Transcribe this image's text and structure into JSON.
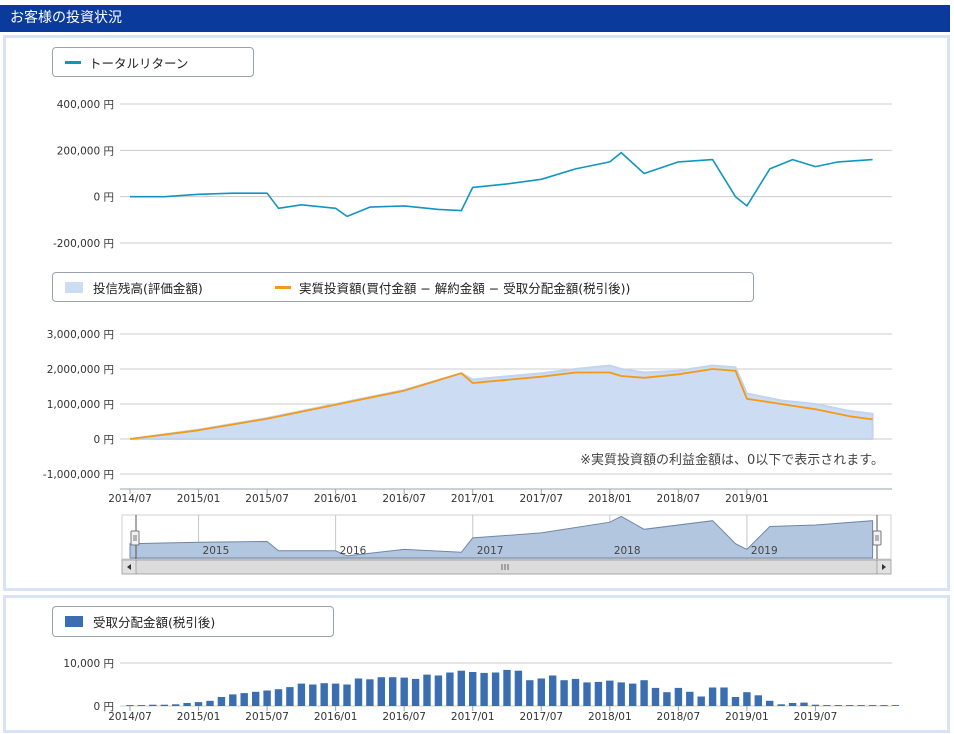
{
  "header": {
    "title": "お客様の投資状況"
  },
  "chart_data": [
    {
      "type": "line",
      "legend": [
        "トータルリターン"
      ],
      "yaxis_ticks": [
        "400,000 円",
        "200,000 円",
        "0 円",
        "-200,000 円"
      ],
      "ylim": [
        -200000,
        400000
      ],
      "xlim": [
        "2014-07",
        "2020-01"
      ],
      "colors": {
        "line": "#1296c1",
        "grid": "#c8c8c8"
      },
      "series": [
        {
          "name": "トータルリターン",
          "x": [
            "2014-07",
            "2014-10",
            "2015-01",
            "2015-04",
            "2015-07",
            "2015-08",
            "2015-10",
            "2016-01",
            "2016-02",
            "2016-04",
            "2016-07",
            "2016-10",
            "2016-12",
            "2017-01",
            "2017-04",
            "2017-07",
            "2017-10",
            "2018-01",
            "2018-02",
            "2018-04",
            "2018-07",
            "2018-10",
            "2018-12",
            "2019-01",
            "2019-03",
            "2019-05",
            "2019-07",
            "2019-09",
            "2019-12"
          ],
          "values": [
            0,
            0,
            10000,
            15000,
            15000,
            -50000,
            -35000,
            -50000,
            -85000,
            -45000,
            -40000,
            -55000,
            -60000,
            40000,
            55000,
            75000,
            120000,
            150000,
            190000,
            100000,
            150000,
            160000,
            0,
            -40000,
            120000,
            160000,
            130000,
            150000,
            160000
          ]
        }
      ]
    },
    {
      "type": "area",
      "legend": [
        "投信残高(評価金額)",
        "実質投資額(買付金額 − 解約金額 − 受取分配金額(税引後))"
      ],
      "yaxis_ticks": [
        "3,000,000 円",
        "2,000,000 円",
        "1,000,000 円",
        "0 円",
        "-1,000,000 円"
      ],
      "ylim": [
        -1000000,
        3000000
      ],
      "x_ticks": [
        "2014/07",
        "2015/01",
        "2015/07",
        "2016/01",
        "2016/07",
        "2017/01",
        "2017/07",
        "2018/01",
        "2018/07",
        "2019/01"
      ],
      "xlim": [
        "2014-07",
        "2020-01"
      ],
      "note": "※実質投資額の利益金額は、0以下で表示されます。",
      "colors": {
        "area_fill": "#ccdcf3",
        "area_edge": "#c3d4ee",
        "line": "#f39a16"
      },
      "series": [
        {
          "name": "投信残高(評価金額)",
          "x": [
            "2014-07",
            "2015-01",
            "2015-07",
            "2016-01",
            "2016-07",
            "2016-12",
            "2017-01",
            "2017-07",
            "2017-10",
            "2018-01",
            "2018-02",
            "2018-04",
            "2018-07",
            "2018-10",
            "2018-12",
            "2019-01",
            "2019-04",
            "2019-07",
            "2019-10",
            "2019-12"
          ],
          "values": [
            0,
            270000,
            600000,
            1000000,
            1400000,
            1880000,
            1700000,
            1880000,
            2000000,
            2100000,
            2000000,
            1900000,
            1950000,
            2100000,
            2050000,
            1300000,
            1100000,
            1000000,
            800000,
            720000
          ]
        },
        {
          "name": "実質投資額(買付金額 − 解約金額 − 受取分配金額(税引後))",
          "x": [
            "2014-07",
            "2015-01",
            "2015-07",
            "2016-01",
            "2016-07",
            "2016-12",
            "2017-01",
            "2017-07",
            "2017-10",
            "2018-01",
            "2018-02",
            "2018-04",
            "2018-07",
            "2018-10",
            "2018-12",
            "2019-01",
            "2019-04",
            "2019-07",
            "2019-10",
            "2019-12"
          ],
          "values": [
            0,
            250000,
            580000,
            980000,
            1380000,
            1880000,
            1600000,
            1780000,
            1900000,
            1900000,
            1800000,
            1750000,
            1850000,
            2000000,
            1950000,
            1150000,
            1000000,
            850000,
            650000,
            560000
          ]
        }
      ]
    },
    {
      "type": "area",
      "role": "navigator",
      "x_ticks": [
        "2015",
        "2016",
        "2017",
        "2018",
        "2019"
      ],
      "xlim": [
        "2014-07",
        "2020-01"
      ],
      "colors": {
        "fill": "#b3c6e0",
        "edge": "#6f86a8"
      },
      "series": [
        {
          "x": [
            "2014-07",
            "2015-01",
            "2015-07",
            "2015-08",
            "2016-01",
            "2016-02",
            "2016-07",
            "2016-12",
            "2017-01",
            "2017-07",
            "2018-01",
            "2018-02",
            "2018-04",
            "2018-10",
            "2018-12",
            "2019-01",
            "2019-03",
            "2019-07",
            "2019-12"
          ],
          "values": [
            0,
            10000,
            15000,
            -50000,
            -50000,
            -85000,
            -40000,
            -60000,
            40000,
            75000,
            150000,
            190000,
            100000,
            160000,
            0,
            -40000,
            120000,
            130000,
            160000
          ]
        }
      ]
    },
    {
      "type": "bar",
      "legend": [
        "受取分配金額(税引後)"
      ],
      "yaxis_ticks": [
        "10,000 円",
        "0 円"
      ],
      "ylim": [
        0,
        10000
      ],
      "x_ticks": [
        "2014/07",
        "2015/01",
        "2015/07",
        "2016/01",
        "2016/07",
        "2017/01",
        "2017/07",
        "2018/01",
        "2018/07",
        "2019/01",
        "2019/07"
      ],
      "xlim": [
        "2014-07",
        "2020-01"
      ],
      "colors": {
        "bar": "#3a6eb0"
      },
      "series": [
        {
          "name": "受取分配金額(税引後)",
          "start": "2014-07",
          "values": [
            200,
            200,
            300,
            300,
            400,
            700,
            900,
            1200,
            2100,
            2700,
            3000,
            3300,
            3600,
            3900,
            4400,
            5200,
            5000,
            5300,
            5200,
            5000,
            6400,
            6200,
            6700,
            6700,
            6600,
            6300,
            7300,
            7100,
            7800,
            8200,
            7900,
            7700,
            7800,
            8400,
            8200,
            6000,
            6400,
            7100,
            6000,
            6300,
            5500,
            5600,
            5900,
            5500,
            5200,
            6000,
            4200,
            3200,
            4200,
            3300,
            2200,
            4300,
            4300,
            2100,
            3200,
            2500,
            1200,
            400,
            700,
            800,
            300,
            200,
            200,
            200,
            200,
            200,
            200,
            200
          ]
        }
      ]
    }
  ]
}
